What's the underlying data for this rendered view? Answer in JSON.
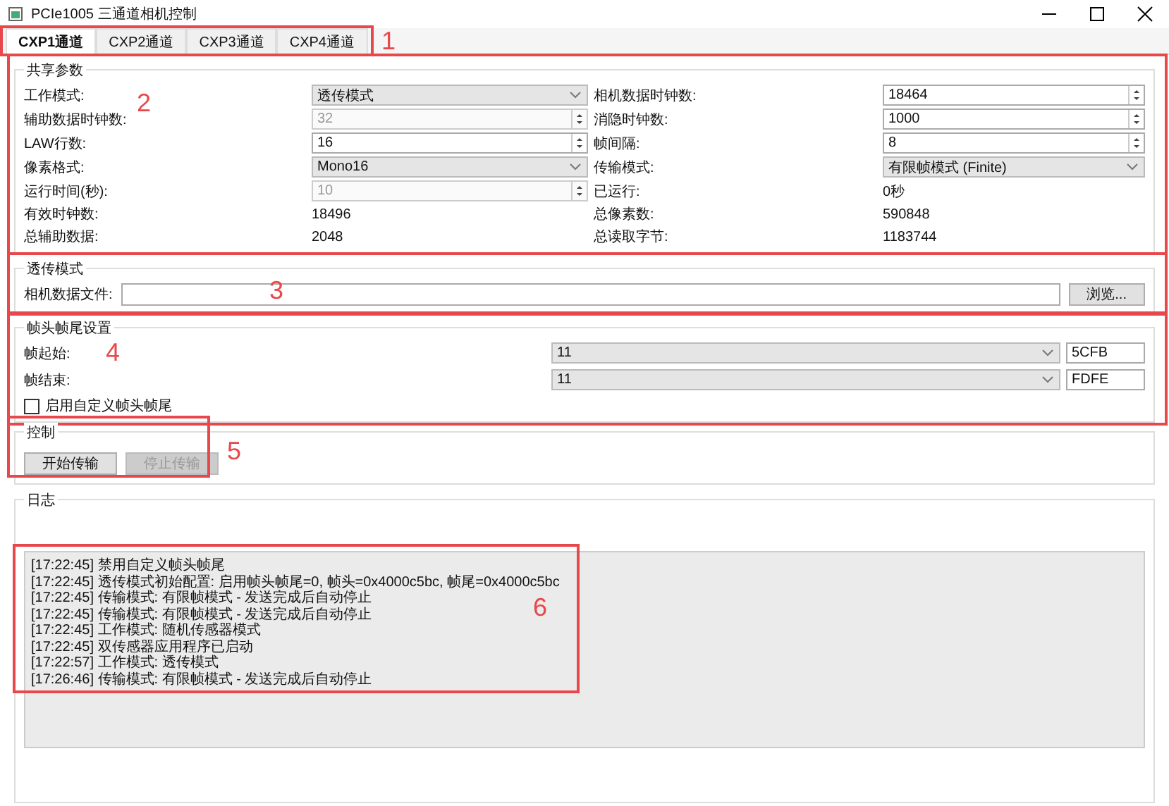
{
  "window": {
    "title": "PCIe1005 三通道相机控制"
  },
  "tabs": [
    {
      "label": "CXP1通道",
      "selected": true
    },
    {
      "label": "CXP2通道",
      "selected": false
    },
    {
      "label": "CXP3通道",
      "selected": false
    },
    {
      "label": "CXP4通道",
      "selected": false
    }
  ],
  "tabs_annotation": "1",
  "shared_params": {
    "title": "共享参数",
    "annotation": "2",
    "fields": [
      {
        "label": "工作模式:",
        "kind": "dropdown",
        "value": "透传模式",
        "disabled": false
      },
      {
        "label": "相机数据时钟数:",
        "kind": "spin",
        "value": "18464",
        "disabled": false
      },
      {
        "label": "辅助数据时钟数:",
        "kind": "spin",
        "value": "32",
        "disabled": true
      },
      {
        "label": "消隐时钟数:",
        "kind": "spin",
        "value": "1000",
        "disabled": false
      },
      {
        "label": "LAW行数:",
        "kind": "spin",
        "value": "16",
        "disabled": false
      },
      {
        "label": "帧间隔:",
        "kind": "spin",
        "value": "8",
        "disabled": false
      },
      {
        "label": "像素格式:",
        "kind": "dropdown",
        "value": "Mono16",
        "disabled": false
      },
      {
        "label": "传输模式:",
        "kind": "dropdown",
        "value": "有限帧模式 (Finite)",
        "disabled": false
      },
      {
        "label": "运行时间(秒):",
        "kind": "spin",
        "value": "10",
        "disabled": true
      },
      {
        "label": "已运行:",
        "kind": "text",
        "value": "0秒"
      },
      {
        "label": "有效时钟数:",
        "kind": "text",
        "value": "18496"
      },
      {
        "label": "总像素数:",
        "kind": "text",
        "value": "590848"
      },
      {
        "label": "总辅助数据:",
        "kind": "text",
        "value": "2048"
      },
      {
        "label": "总读取字节:",
        "kind": "text",
        "value": "1183744"
      }
    ]
  },
  "transparent_mode": {
    "title": "透传模式",
    "annotation": "3",
    "file_label": "相机数据文件:",
    "browse_button": "浏览..."
  },
  "frame_settings": {
    "title": "帧头帧尾设置",
    "annotation": "4",
    "rows": [
      {
        "label": "帧起始:",
        "select": "11",
        "hex": "5CFB"
      },
      {
        "label": "帧结束:",
        "select": "11",
        "hex": "FDFE"
      }
    ],
    "checkbox": {
      "label": "启用自定义帧头帧尾",
      "checked": false
    }
  },
  "control": {
    "title": "控制",
    "annotation": "5",
    "buttons": [
      {
        "label": "开始传输",
        "disabled": false
      },
      {
        "label": "停止传输",
        "disabled": true
      }
    ]
  },
  "log": {
    "title": "日志",
    "annotation": "6",
    "lines": [
      "[17:22:45] 禁用自定义帧头帧尾",
      "[17:22:45] 透传模式初始配置: 启用帧头帧尾=0, 帧头=0x4000c5bc, 帧尾=0x4000c5bc",
      "[17:22:45] 传输模式: 有限帧模式 - 发送完成后自动停止",
      "[17:22:45] 传输模式: 有限帧模式 - 发送完成后自动停止",
      "[17:22:45] 工作模式: 随机传感器模式",
      "[17:22:45] 双传感器应用程序已启动",
      "[17:22:57] 工作模式: 透传模式",
      "[17:26:46] 传输模式: 有限帧模式 - 发送完成后自动停止"
    ]
  }
}
